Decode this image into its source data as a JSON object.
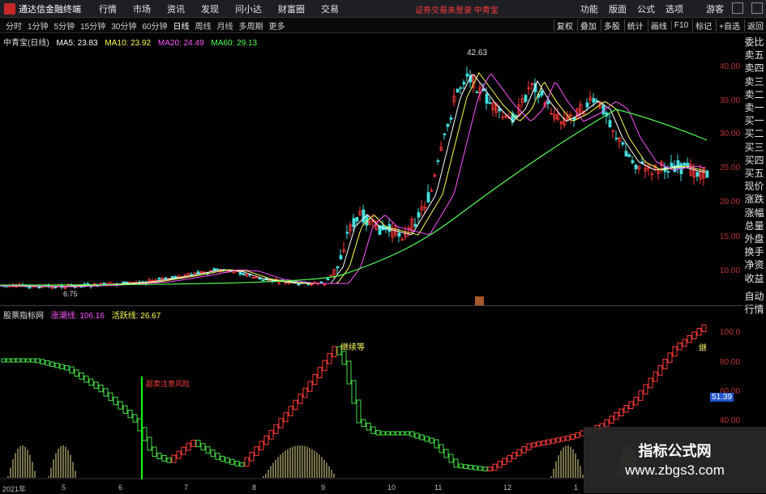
{
  "topbar": {
    "app_title": "通达信金融终端",
    "menus": [
      "行情",
      "市场",
      "资讯",
      "发现",
      "问小达",
      "财富圈",
      "交易"
    ],
    "notice": "证券交易未登录  中青宝",
    "right_menus": [
      "功能",
      "版面",
      "公式",
      "选项"
    ],
    "user": "游客"
  },
  "periods": [
    "分时",
    "1分钟",
    "5分钟",
    "15分钟",
    "30分钟",
    "60分钟",
    "日线",
    "周线",
    "月线",
    "多周期",
    "更多"
  ],
  "active_period": "日线",
  "toolbar": [
    "复权",
    "叠加",
    "多股",
    "统计",
    "画线",
    "F10",
    "标记",
    "+自选",
    "返回"
  ],
  "main_legend": {
    "stock": "中青宝(日线)",
    "ma5": "MA5: 23.83",
    "ma10": "MA10: 23.92",
    "ma20": "MA20: 24.49",
    "ma60": "MA60: 29.13",
    "colors": {
      "ma5": "#ffffff",
      "ma10": "#ffff55",
      "ma20": "#ff55ff",
      "ma60": "#55ff55"
    }
  },
  "price_axis": [
    "40.00",
    "35.00",
    "30.00",
    "25.00",
    "20.00",
    "15.00",
    "10.00"
  ],
  "high_label": "42.63",
  "low_label": "6.75",
  "sub_legend": {
    "name": "股票指标网",
    "line1": "涨潮线: 106.16",
    "line2": "活跃线: 26.67"
  },
  "sub_axis": [
    "100.0",
    "80.00",
    "60.00",
    "40.00"
  ],
  "sub_current": "51.39",
  "annotations": {
    "warning": "超卖注意风险",
    "continue": "继续等",
    "right_cut": "继"
  },
  "x_axis": [
    "2021年",
    "5",
    "6",
    "7",
    "8",
    "9",
    "10",
    "11",
    "12",
    "1"
  ],
  "right_panel": [
    "委比",
    "卖五",
    "卖四",
    "卖三",
    "卖二",
    "卖一",
    "买一",
    "买二",
    "买三",
    "买四",
    "买五",
    "现价",
    "涨跌",
    "涨幅",
    "总量",
    "外盘",
    "换手",
    "净资",
    "收益"
  ],
  "right_panel_sub": [
    "自动",
    "行情"
  ],
  "watermark": {
    "title": "指标公式网",
    "url": "www.zbgs3.com"
  }
}
